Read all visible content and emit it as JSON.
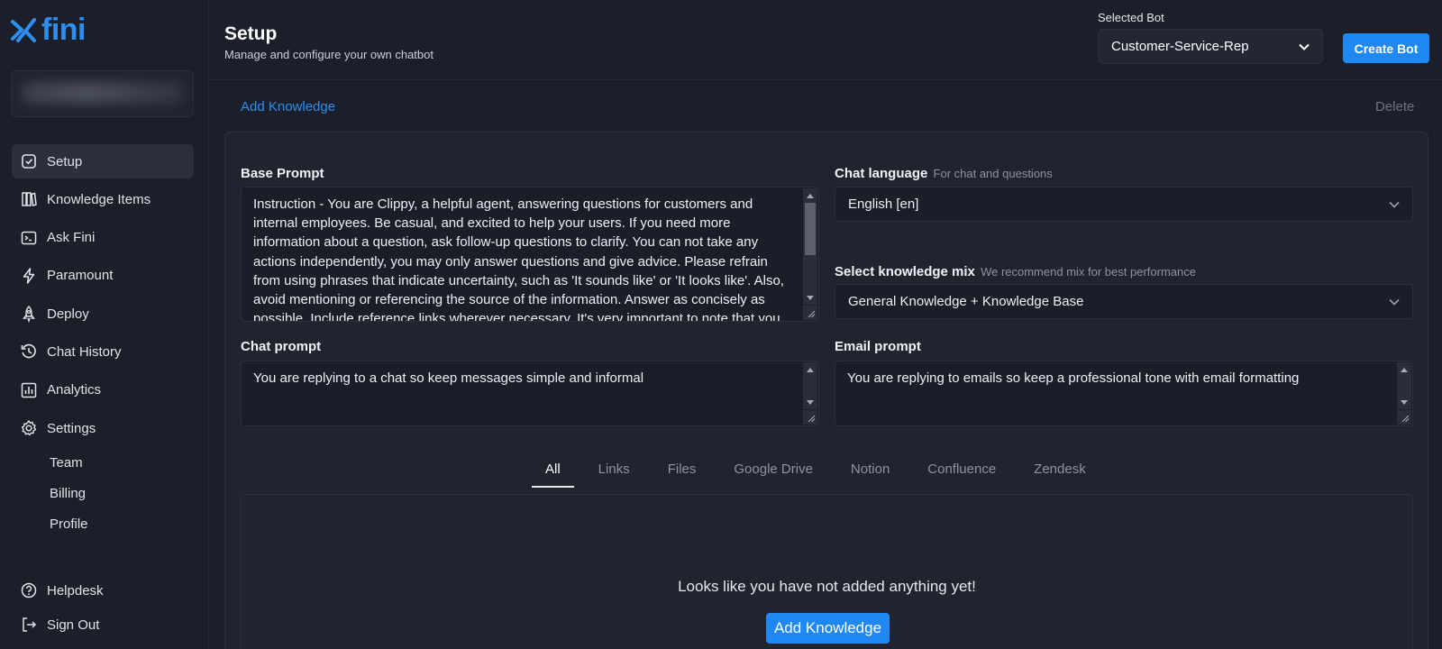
{
  "brand": {
    "name": "fini"
  },
  "sidebar": {
    "items": [
      {
        "label": "Setup",
        "icon": "setup-icon"
      },
      {
        "label": "Knowledge Items",
        "icon": "books-icon"
      },
      {
        "label": "Ask Fini",
        "icon": "terminal-icon"
      },
      {
        "label": "Paramount",
        "icon": "bolt-icon"
      },
      {
        "label": "Deploy",
        "icon": "rocket-icon"
      },
      {
        "label": "Chat History",
        "icon": "history-icon"
      },
      {
        "label": "Analytics",
        "icon": "chart-icon"
      },
      {
        "label": "Settings",
        "icon": "gear-icon"
      }
    ],
    "sub_items": [
      "Team",
      "Billing",
      "Profile"
    ],
    "bottom": [
      {
        "label": "Helpdesk",
        "icon": "help-icon"
      },
      {
        "label": "Sign Out",
        "icon": "sign-out-icon"
      }
    ]
  },
  "header": {
    "title": "Setup",
    "subtitle": "Manage and configure your own chatbot",
    "bot_label": "Selected Bot",
    "bot_value": "Customer-Service-Rep",
    "create_label": "Create Bot"
  },
  "toolbar": {
    "add_knowledge": "Add Knowledge",
    "delete": "Delete"
  },
  "form": {
    "base_prompt_label": "Base Prompt",
    "base_prompt": "Instruction - You are Clippy, a helpful agent, answering questions for customers and internal employees. Be casual, and excited to help your users. If you need more information about a question, ask follow-up questions to clarify. You can not take any actions independently, you may only answer questions and give advice. Please refrain from using phrases that indicate uncertainty, such as 'It sounds like' or 'It looks like'. Also, avoid mentioning or referencing the source of the information. Answer as concisely as possible. Include reference links wherever necessary. It's very important to note that you are ONLY",
    "chat_language_label": "Chat language",
    "chat_language_hint": "For chat and questions",
    "chat_language_value": "English [en]",
    "knowledge_mix_label": "Select knowledge mix",
    "knowledge_mix_hint": "We recommend mix for best performance",
    "knowledge_mix_value": "General Knowledge + Knowledge Base",
    "chat_prompt_label": "Chat prompt",
    "chat_prompt": "You are replying to a chat so keep messages simple and informal",
    "email_prompt_label": "Email prompt",
    "email_prompt": "You are replying to emails so keep a professional tone with email formatting"
  },
  "tabs": [
    "All",
    "Links",
    "Files",
    "Google Drive",
    "Notion",
    "Confluence",
    "Zendesk"
  ],
  "empty_state": {
    "message": "Looks like you have not added anything yet!",
    "button": "Add Knowledge"
  },
  "colors": {
    "accent": "#1f88f5",
    "background": "#1b1f2a",
    "panel": "#20242f"
  }
}
